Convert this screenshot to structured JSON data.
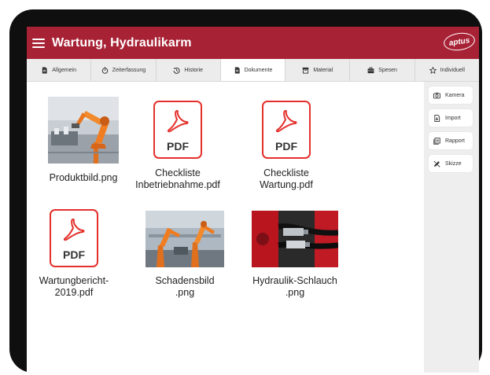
{
  "app": {
    "title": "Wartung, Hydraulikarm",
    "logo_text": "aptus",
    "brand_color": "#a82235"
  },
  "tabs": [
    {
      "label": "Allgemein",
      "icon": "document-icon"
    },
    {
      "label": "Zeiterfassung",
      "icon": "stopwatch-icon"
    },
    {
      "label": "Historie",
      "icon": "history-icon"
    },
    {
      "label": "Dokumente",
      "icon": "document-icon",
      "active": true
    },
    {
      "label": "Material",
      "icon": "box-icon"
    },
    {
      "label": "Spesen",
      "icon": "briefcase-icon"
    },
    {
      "label": "Individuell",
      "icon": "star-icon"
    }
  ],
  "files": [
    {
      "name": "Produktbild.png",
      "type": "image"
    },
    {
      "name": "Checkliste Inbetriebnahme.pdf",
      "name_line1": "Checkliste",
      "name_line2": "Inbetriebnahme.pdf",
      "type": "pdf"
    },
    {
      "name": "Checkliste Wartung.pdf",
      "name_line1": "Checkliste",
      "name_line2": "Wartung.pdf",
      "type": "pdf"
    },
    {
      "name": "Wartungbericht-2019.pdf",
      "name_line1": "Wartungbericht-",
      "name_line2": "2019.pdf",
      "type": "pdf"
    },
    {
      "name": "Schadensbild.png",
      "name_line1": "Schadensbild",
      "name_line2": ".png",
      "type": "image"
    },
    {
      "name": "Hydraulik-Schlauch.png",
      "name_line1": "Hydraulik-Schlauch",
      "name_line2": ".png",
      "type": "image"
    }
  ],
  "pdf_label": "PDF",
  "sidebar": [
    {
      "label": "Kamera",
      "icon": "camera-icon"
    },
    {
      "label": "Import",
      "icon": "import-icon"
    },
    {
      "label": "Rapport",
      "icon": "report-icon"
    },
    {
      "label": "Skizze",
      "icon": "sketch-icon"
    }
  ]
}
